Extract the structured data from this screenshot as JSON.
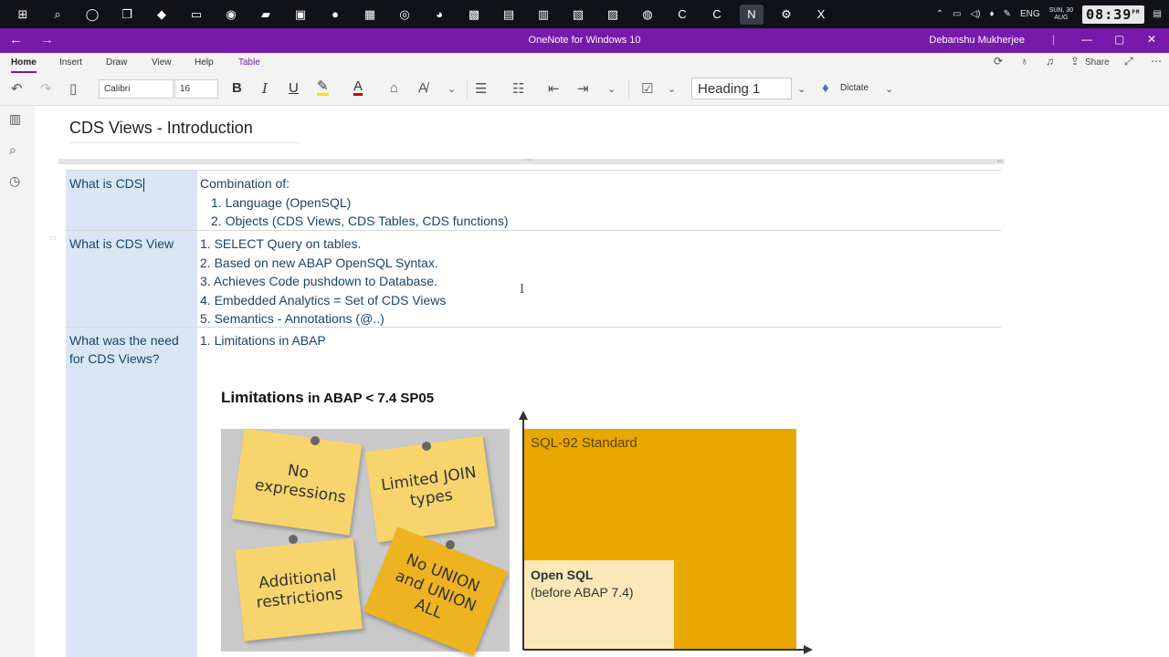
{
  "taskbar": {
    "apps": [
      {
        "icon": "windows-start-icon",
        "glyph": "⊞"
      },
      {
        "icon": "search-icon",
        "glyph": "⌕"
      },
      {
        "icon": "cortana-icon",
        "glyph": "◯"
      },
      {
        "icon": "task-view-icon",
        "glyph": "❐"
      },
      {
        "icon": "app-icon-1",
        "glyph": "◆"
      },
      {
        "icon": "file-explorer-icon",
        "glyph": "▭"
      },
      {
        "icon": "app-icon-2",
        "glyph": "◉"
      },
      {
        "icon": "app-icon-3",
        "glyph": "▰"
      },
      {
        "icon": "app-icon-4",
        "glyph": "▣"
      },
      {
        "icon": "zoom-icon",
        "glyph": "●"
      },
      {
        "icon": "app-icon-5",
        "glyph": "▦"
      },
      {
        "icon": "chrome-icon",
        "glyph": "◎"
      },
      {
        "icon": "app-icon-6",
        "glyph": "◕"
      },
      {
        "icon": "app-icon-7",
        "glyph": "▩"
      },
      {
        "icon": "outlook-icon",
        "glyph": "▤"
      },
      {
        "icon": "teams-icon",
        "glyph": "▥"
      },
      {
        "icon": "snipping-icon",
        "glyph": "▧"
      },
      {
        "icon": "app-icon-8",
        "glyph": "▨"
      },
      {
        "icon": "whatsapp-icon",
        "glyph": "◍"
      },
      {
        "icon": "camtasia-icon",
        "glyph": "C"
      },
      {
        "icon": "app-icon-9",
        "glyph": "C"
      },
      {
        "icon": "onenote-icon",
        "glyph": "N"
      },
      {
        "icon": "settings-icon",
        "glyph": "⚙"
      },
      {
        "icon": "excel-icon",
        "glyph": "X"
      }
    ],
    "tray": {
      "language": "ENG",
      "date_line1": "SUN, 30",
      "date_line2": "AUG",
      "clock": "08:39",
      "ampm": "PM"
    }
  },
  "titlebar": {
    "title": "OneNote for Windows 10",
    "user": "Debanshu Mukherjee",
    "back": "←",
    "forward": "→",
    "minimize": "—",
    "maximize": "▢",
    "close": "✕"
  },
  "ribbon": {
    "tabs": [
      "Home",
      "Insert",
      "Draw",
      "View",
      "Help",
      "Table"
    ],
    "share_label": "Share",
    "font_name": "Calibri",
    "font_size": "16",
    "style": "Heading 1",
    "dictate_label": "Dictate"
  },
  "page": {
    "title": "CDS Views - Introduction",
    "rows": [
      {
        "left": "What is CDS",
        "right_heading": "Combination of:",
        "right_items": [
          "1. Language (OpenSQL)",
          "2. Objects (CDS Views, CDS Tables, CDS functions)"
        ]
      },
      {
        "left": "What is CDS View",
        "right_items": [
          "1. SELECT Query on tables.",
          "2. Based on new ABAP OpenSQL Syntax.",
          "3. Achieves Code pushdown to Database.",
          "4. Embedded Analytics = Set of CDS Views",
          "5. Semantics - Annotations (@..)"
        ]
      },
      {
        "left": "What was the need for CDS Views?",
        "right_items": [
          "1. Limitations in ABAP"
        ]
      }
    ],
    "slide": {
      "title_bold": "Limitations",
      "title_rest": "in ABAP < 7.4 SP05",
      "notes": [
        "No expressions",
        "Limited JOIN types",
        "Additional restrictions",
        "No UNION and UNION ALL"
      ],
      "sql92_label": "SQL-92 Standard",
      "opensql_label": "Open SQL",
      "opensql_sub": "(before ABAP 7.4)",
      "colors": {
        "sql92": "#e8a800",
        "opensql": "#fbe7b8",
        "note_pale": "#f8d46d",
        "note_gold": "#eeb320"
      }
    }
  }
}
